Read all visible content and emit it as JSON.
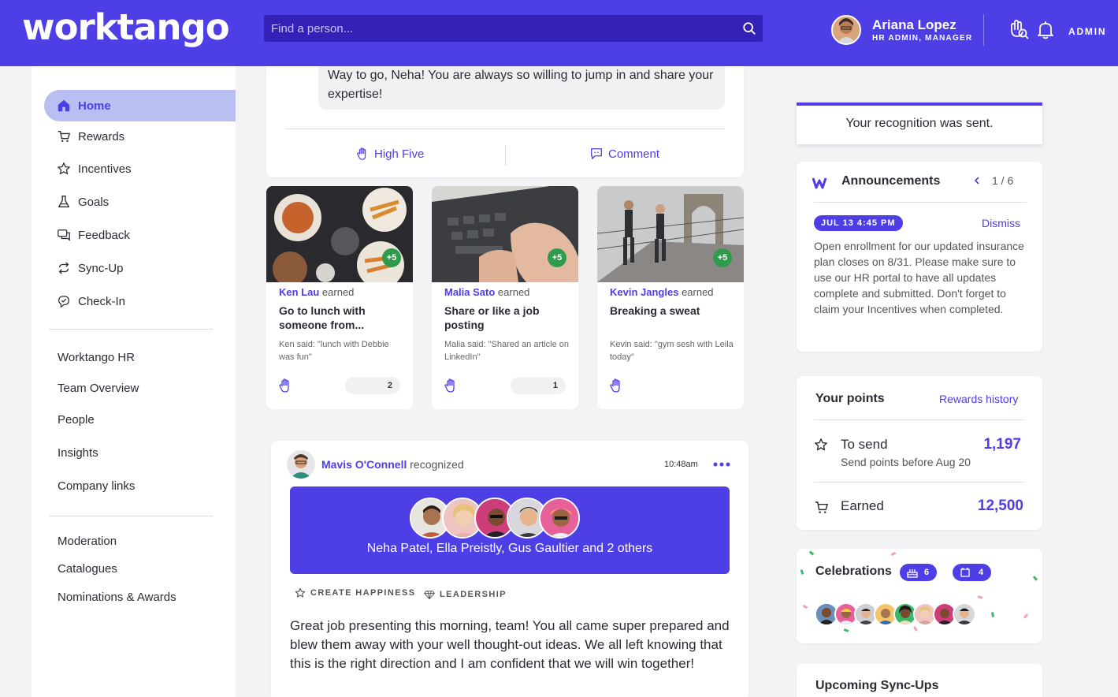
{
  "header": {
    "logo": "worktango",
    "search_placeholder": "Find a person...",
    "user_name": "Ariana Lopez",
    "user_role": "HR ADMIN, MANAGER",
    "admin_label": "ADMIN"
  },
  "sidebar": {
    "items": [
      {
        "label": "Home",
        "icon": "home-icon",
        "active": true
      },
      {
        "label": "Rewards",
        "icon": "cart-icon"
      },
      {
        "label": "Incentives",
        "icon": "star-icon"
      },
      {
        "label": "Goals",
        "icon": "flask-icon"
      },
      {
        "label": "Feedback",
        "icon": "chat-icon"
      },
      {
        "label": "Sync-Up",
        "icon": "sync-icon"
      },
      {
        "label": "Check-In",
        "icon": "checkin-icon"
      }
    ],
    "links": [
      "Worktango HR",
      "Team Overview",
      "People",
      "Insights",
      "Company links"
    ],
    "admin_links": [
      "Moderation",
      "Catalogues",
      "Nominations & Awards"
    ]
  },
  "feed": {
    "comment_text": "Way to go, Neha! You are always so willing to jump in and share your expertise!",
    "high_five_label": "High Five",
    "comment_label": "Comment",
    "earned_cards": [
      {
        "name": "Ken Lau",
        "verb": "earned",
        "title": "Go to lunch with someone from...",
        "said": "Ken said: \"lunch with Debbie was fun\"",
        "count": "2",
        "plus": "+5"
      },
      {
        "name": "Malia Sato",
        "verb": "earned",
        "title": "Share or like a job posting",
        "said": "Malia said: \"Shared an article on LinkedIn\"",
        "count": "1",
        "plus": "+5"
      },
      {
        "name": "Kevin Jangles",
        "verb": "earned",
        "title": "Breaking a sweat",
        "said": "Kevin said: \"gym sesh with Leila today\"",
        "count": "",
        "plus": "+5"
      }
    ],
    "post": {
      "author": "Mavis O'Connell",
      "verb": "recognized",
      "time": "10:48am",
      "recipients": "Neha Patel, Ella Preistly, Gus Gaultier and 2 others",
      "tags": [
        "CREATE HAPPINESS",
        "LEADERSHIP"
      ],
      "body": "Great job presenting this morning, team! You all came super prepared and blew them away with your well thought-out ideas. We all left knowing that this is the right direction and I am confident that we will win together!"
    }
  },
  "right": {
    "toast": "Your recognition was sent.",
    "announcements": {
      "title": "Announcements",
      "pager": "1 / 6",
      "date": "JUL 13 4:45 PM",
      "dismiss": "Dismiss",
      "text": "Open enrollment for our updated insurance plan closes on 8/31.  Please make sure to use our HR portal to have all updates complete and submitted. Don't forget to claim your Incentives when completed."
    },
    "points": {
      "title": "Your points",
      "history": "Rewards history",
      "to_send_label": "To send",
      "to_send_value": "1,197",
      "to_send_sub": "Send points before Aug 20",
      "earned_label": "Earned",
      "earned_value": "12,500"
    },
    "celebrations": {
      "title": "Celebrations",
      "birthdays": "6",
      "anniversaries": "4"
    },
    "syncups": {
      "title": "Upcoming Sync-Ups"
    }
  },
  "colors": {
    "brand": "#4d3ee6",
    "search_bg": "#3422b8",
    "active_nav": "#b9bff0",
    "plus_badge": "#2f9b4c"
  }
}
